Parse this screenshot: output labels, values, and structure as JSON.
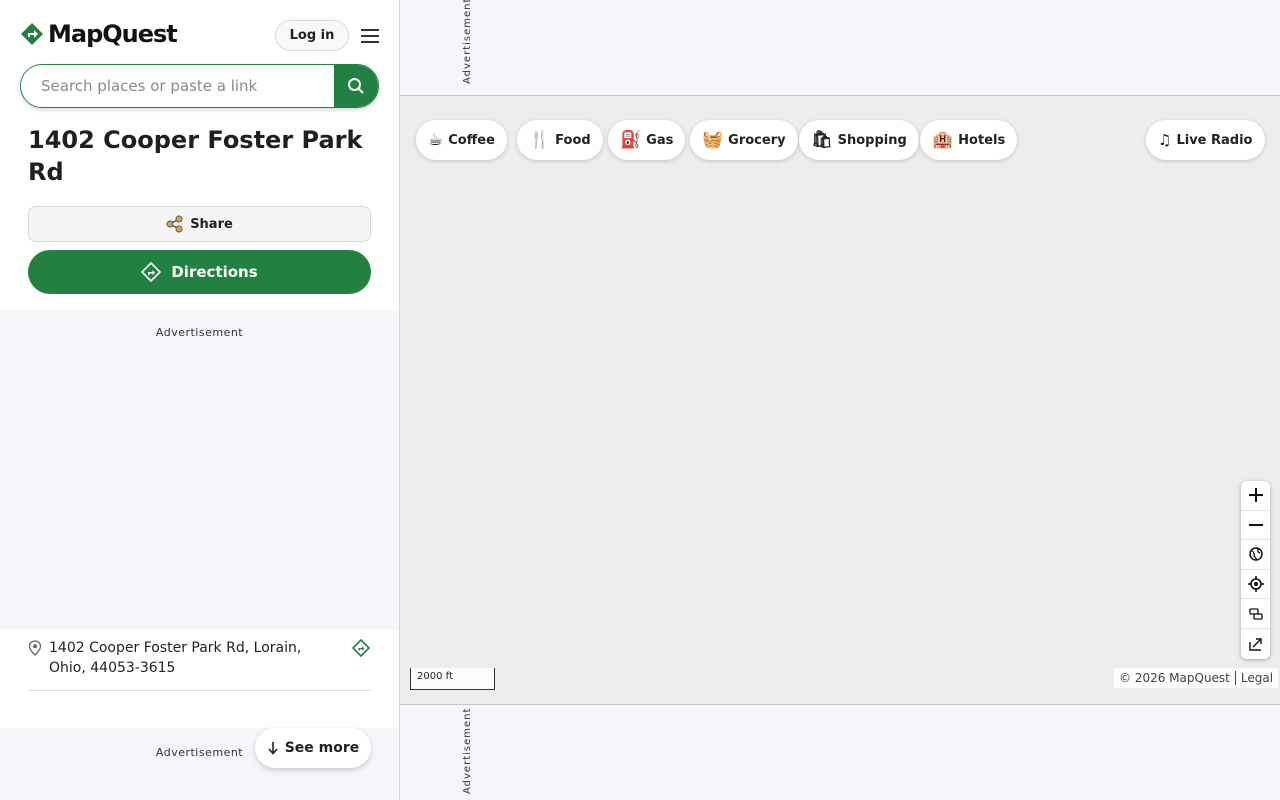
{
  "header": {
    "logo_text": "MapQuest",
    "login_label": "Log in"
  },
  "search": {
    "placeholder": "Search places or paste a link",
    "value": ""
  },
  "place": {
    "title": "1402 Cooper Foster Park Rd",
    "share_label": "Share",
    "directions_label": "Directions",
    "address": "1402 Cooper Foster Park Rd, Lorain, Ohio, 44053-3615"
  },
  "ads": {
    "label": "Advertisement"
  },
  "see_more_label": "See more",
  "categories": [
    {
      "label": "Coffee",
      "icon": "coffee-icon",
      "glyph": "☕"
    },
    {
      "label": "Food",
      "icon": "food-icon",
      "glyph": "🍴"
    },
    {
      "label": "Gas",
      "icon": "gas-icon",
      "glyph": "⛽"
    },
    {
      "label": "Grocery",
      "icon": "grocery-icon",
      "glyph": "🧺"
    },
    {
      "label": "Shopping",
      "icon": "shopping-icon",
      "glyph": "🛍"
    },
    {
      "label": "Hotels",
      "icon": "hotels-icon",
      "glyph": "🏨"
    }
  ],
  "live_radio_label": "Live Radio",
  "map": {
    "scale_label": "2000 ft",
    "copyright": "© 2026 MapQuest",
    "legal_label": "Legal"
  },
  "colors": {
    "brand_green": "#238043",
    "map_bg": "#ededed",
    "ad_bg": "#f5f5fa"
  }
}
